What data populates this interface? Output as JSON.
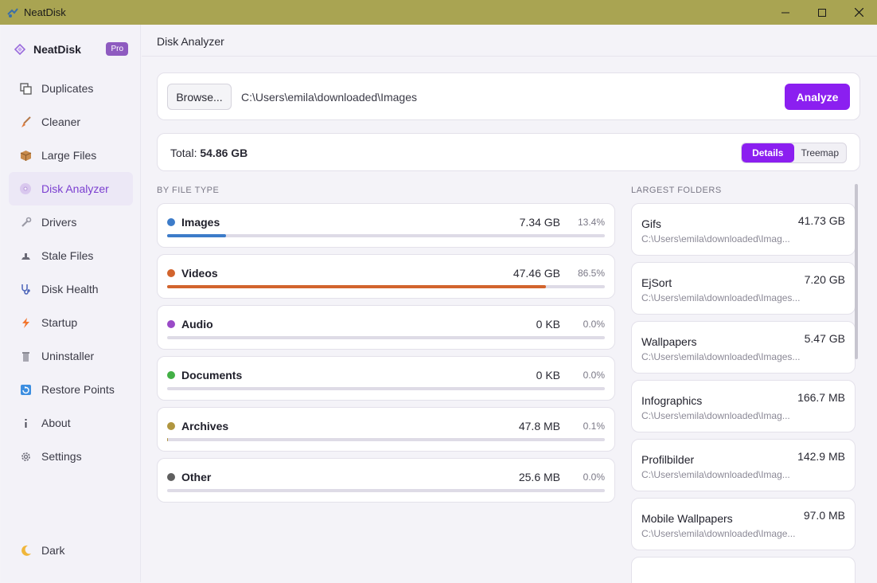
{
  "window": {
    "title": "NeatDisk"
  },
  "brand": {
    "name": "NeatDisk",
    "badge": "Pro"
  },
  "sidebar": {
    "items": [
      {
        "label": "Duplicates",
        "icon": "duplicates-icon"
      },
      {
        "label": "Cleaner",
        "icon": "broom-icon"
      },
      {
        "label": "Large Files",
        "icon": "package-icon"
      },
      {
        "label": "Disk Analyzer",
        "icon": "disc-icon",
        "active": true
      },
      {
        "label": "Drivers",
        "icon": "wrench-icon"
      },
      {
        "label": "Stale Files",
        "icon": "stale-icon"
      },
      {
        "label": "Disk Health",
        "icon": "stethoscope-icon"
      },
      {
        "label": "Startup",
        "icon": "lightning-icon"
      },
      {
        "label": "Uninstaller",
        "icon": "trash-icon"
      },
      {
        "label": "Restore Points",
        "icon": "restore-icon"
      },
      {
        "label": "About",
        "icon": "info-icon"
      },
      {
        "label": "Settings",
        "icon": "gear-icon"
      }
    ],
    "dark_label": "Dark"
  },
  "header": {
    "title": "Disk Analyzer"
  },
  "browse": {
    "button_label": "Browse...",
    "path": "C:\\Users\\emila\\downloaded\\Images",
    "analyze_label": "Analyze"
  },
  "summary": {
    "total_label": "Total:",
    "total_value": "54.86 GB",
    "view_options": [
      "Details",
      "Treemap"
    ],
    "selected_view": "Details"
  },
  "file_types": {
    "section_label": "BY FILE TYPE",
    "items": [
      {
        "name": "Images",
        "size": "7.34 GB",
        "percent": "13.4%",
        "fraction": 0.134,
        "color": "#3d7cc9"
      },
      {
        "name": "Videos",
        "size": "47.46 GB",
        "percent": "86.5%",
        "fraction": 0.865,
        "color": "#d2642d"
      },
      {
        "name": "Audio",
        "size": "0 KB",
        "percent": "0.0%",
        "fraction": 0.0,
        "color": "#9a4ac7"
      },
      {
        "name": "Documents",
        "size": "0 KB",
        "percent": "0.0%",
        "fraction": 0.0,
        "color": "#43b046"
      },
      {
        "name": "Archives",
        "size": "47.8 MB",
        "percent": "0.1%",
        "fraction": 0.001,
        "color": "#b0963f"
      },
      {
        "name": "Other",
        "size": "25.6 MB",
        "percent": "0.0%",
        "fraction": 0.0,
        "color": "#5f5f5f"
      }
    ]
  },
  "largest_folders": {
    "section_label": "LARGEST FOLDERS",
    "items": [
      {
        "name": "Gifs",
        "size": "41.73 GB",
        "path": "C:\\Users\\emila\\downloaded\\Imag..."
      },
      {
        "name": "EjSort",
        "size": "7.20 GB",
        "path": "C:\\Users\\emila\\downloaded\\Images..."
      },
      {
        "name": "Wallpapers",
        "size": "5.47 GB",
        "path": "C:\\Users\\emila\\downloaded\\Images..."
      },
      {
        "name": "Infographics",
        "size": "166.7 MB",
        "path": "C:\\Users\\emila\\downloaded\\Imag..."
      },
      {
        "name": "Profilbilder",
        "size": "142.9 MB",
        "path": "C:\\Users\\emila\\downloaded\\Imag..."
      },
      {
        "name": "Mobile Wallpapers",
        "size": "97.0 MB",
        "path": "C:\\Users\\emila\\downloaded\\Image..."
      }
    ]
  },
  "colors": {
    "accent": "#8b1ff0",
    "titlebar": "#a9a452",
    "brand_badge": "#8e5bc0"
  }
}
